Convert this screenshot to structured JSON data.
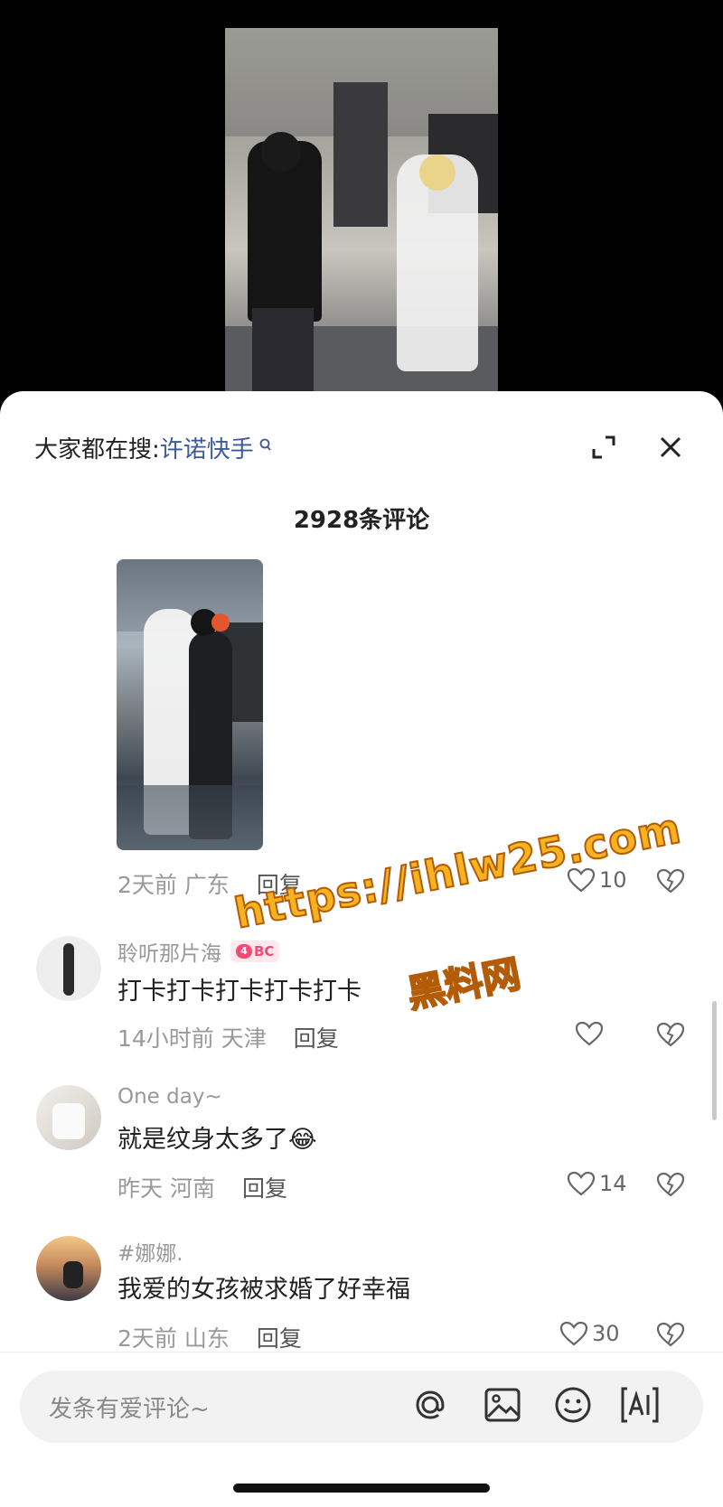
{
  "search": {
    "prefix": "大家都在搜:",
    "term": "许诺快手",
    "icon": "search-icon"
  },
  "comment_count": "2928条评论",
  "comments": [
    {
      "location": "2天前 广东",
      "reply": "回复",
      "likes": "10"
    },
    {
      "username": "聆听那片海",
      "badge": "BC",
      "badge_level": "4",
      "text": "打卡打卡打卡打卡打卡",
      "location": "14小时前 天津",
      "reply": "回复",
      "likes": ""
    },
    {
      "username": "One day~",
      "text": "就是纹身太多了",
      "emoji": "😂",
      "location": "昨天 河南",
      "reply": "回复",
      "likes": "14"
    },
    {
      "username": "#娜娜.",
      "text": "我爱的女孩被求婚了好幸福",
      "location": "2天前 山东",
      "reply": "回复",
      "likes": "30"
    }
  ],
  "watermark": {
    "line1": "https://ihlw25.com",
    "line2": "黑料网"
  },
  "input": {
    "placeholder": "发条有爱评论~"
  },
  "icons": [
    "at-icon",
    "image-icon",
    "emoji-icon",
    "ai-icon",
    "expand-icon",
    "close-icon",
    "heart-icon",
    "dislike-icon"
  ],
  "colors": {
    "link": "#3d5a98",
    "watermark": "#f6b31f",
    "badge": "#f04b74"
  }
}
